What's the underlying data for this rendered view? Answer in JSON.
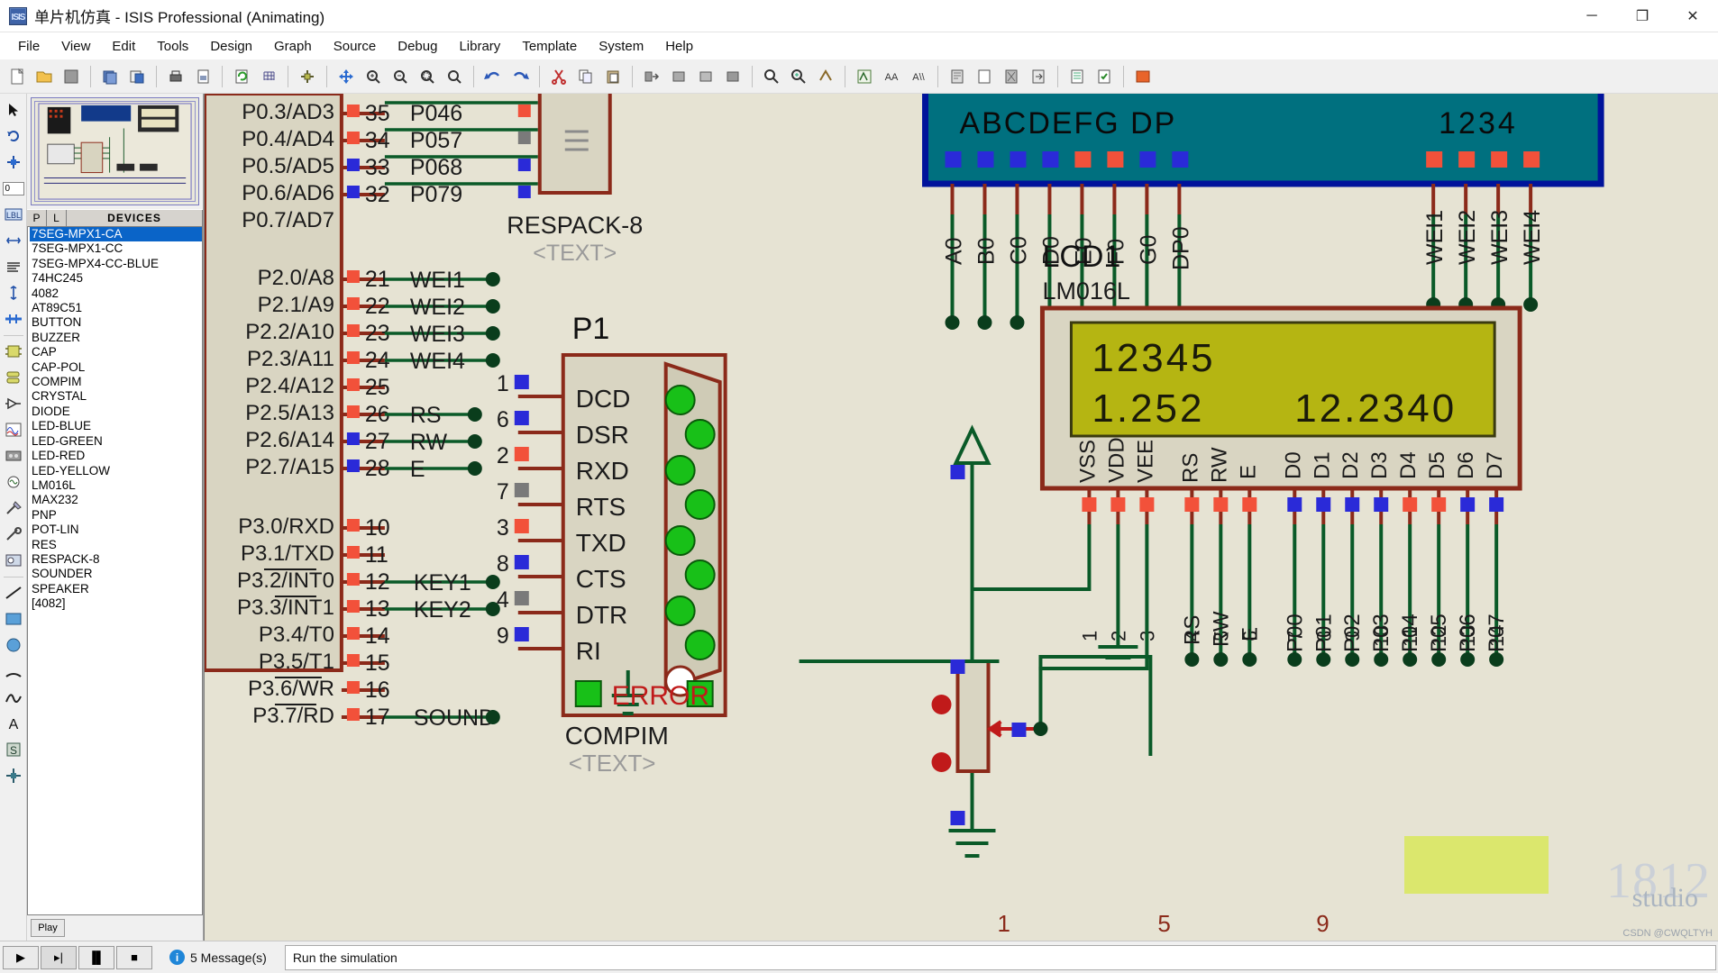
{
  "window": {
    "title": "单片机仿真 - ISIS Professional (Animating)",
    "app_icon": "isis-icon",
    "minimize": "─",
    "maximize": "❐",
    "close": "✕"
  },
  "menubar": {
    "items": [
      {
        "label": "File"
      },
      {
        "label": "View"
      },
      {
        "label": "Edit"
      },
      {
        "label": "Tools"
      },
      {
        "label": "Design"
      },
      {
        "label": "Graph"
      },
      {
        "label": "Source"
      },
      {
        "label": "Debug"
      },
      {
        "label": "Library"
      },
      {
        "label": "Template"
      },
      {
        "label": "System"
      },
      {
        "label": "Help"
      }
    ]
  },
  "toolbar": {
    "groups": [
      [
        "new-file-icon",
        "open-folder-icon",
        "save-icon"
      ],
      [
        "import-section-icon",
        "export-section-icon"
      ],
      [
        "print-icon",
        "print-region-icon"
      ],
      [
        "refresh-icon",
        "grid-icon"
      ],
      [
        "origin-icon"
      ],
      [
        "pan-icon",
        "zoom-in-icon",
        "zoom-out-icon",
        "zoom-area-icon",
        "zoom-all-icon"
      ],
      [
        "undo-icon",
        "redo-icon"
      ],
      [
        "cut-icon",
        "copy-icon",
        "paste-icon"
      ],
      [
        "block-copy-icon",
        "block-move-icon",
        "block-rotate-icon",
        "block-delete-icon"
      ],
      [
        "pick-device-icon",
        "make-device-icon",
        "packaging-icon",
        "decompose-icon"
      ],
      [
        "wire-autorouter-icon",
        "search-tag-icon",
        "property-assign-icon"
      ],
      [
        "design-explorer-icon",
        "new-sheet-icon",
        "remove-sheet-icon",
        "exit-sheet-icon"
      ],
      [
        "bill-materials-icon",
        "erc-report-icon"
      ],
      [
        "netlist-transfer-icon"
      ]
    ]
  },
  "vtoolbar": {
    "items": [
      {
        "name": "selection-mode-icon",
        "glyph": "arrow"
      },
      {
        "name": "component-mode-icon",
        "glyph": "comp"
      },
      {
        "name": "junction-dot-icon",
        "glyph": "junction"
      },
      {
        "name": "wire-label-icon",
        "glyph": "LBL"
      },
      {
        "name": "text-script-icon",
        "glyph": "text"
      },
      {
        "name": "bus-mode-icon",
        "glyph": "bus"
      },
      {
        "name": "subcircuit-icon",
        "glyph": "subckt"
      },
      {
        "name": "terminal-mode-icon",
        "glyph": "term"
      },
      {
        "name": "device-pin-icon",
        "glyph": "pin"
      },
      {
        "name": "graph-mode-icon",
        "glyph": "graph"
      },
      {
        "name": "tape-recorder-icon",
        "glyph": "tape"
      },
      {
        "name": "generator-mode-icon",
        "glyph": "gen"
      },
      {
        "name": "voltage-probe-icon",
        "glyph": "probe"
      },
      {
        "name": "current-probe-icon",
        "glyph": "iprobe"
      },
      {
        "name": "virtual-instrument-icon",
        "glyph": "instr"
      },
      {
        "name": "line-tool-icon",
        "glyph": "line"
      },
      {
        "name": "box-tool-icon",
        "glyph": "box"
      },
      {
        "name": "circle-tool-icon",
        "glyph": "circle"
      },
      {
        "name": "arc-tool-icon",
        "glyph": "arc"
      },
      {
        "name": "path-tool-icon",
        "glyph": "path"
      },
      {
        "name": "text-tool-icon",
        "glyph": "A"
      },
      {
        "name": "symbol-tool-icon",
        "glyph": "S"
      },
      {
        "name": "marker-tool-icon",
        "glyph": "marker"
      }
    ],
    "rotate_icons": [
      {
        "name": "rotate-clockwise-icon"
      },
      {
        "name": "rotate-anticlockwise-icon"
      }
    ],
    "rotate_value": "0",
    "mirror_icons": [
      {
        "name": "mirror-horizontal-icon"
      },
      {
        "name": "mirror-vertical-icon"
      }
    ]
  },
  "devices_panel": {
    "columns": [
      "P",
      "L",
      "DEVICES"
    ],
    "items": [
      "7SEG-MPX1-CA",
      "7SEG-MPX1-CC",
      "7SEG-MPX4-CC-BLUE",
      "74HC245",
      "4082",
      "AT89C51",
      "BUTTON",
      "BUZZER",
      "CAP",
      "CAP-POL",
      "COMPIM",
      "CRYSTAL",
      "DIODE",
      "LED-BLUE",
      "LED-GREEN",
      "LED-RED",
      "LED-YELLOW",
      "LM016L",
      "MAX232",
      "PNP",
      "POT-LIN",
      "RES",
      "RESPACK-8",
      "SOUNDER",
      "SPEAKER",
      "[4082]"
    ],
    "selected_index": 0,
    "play_label": "Play"
  },
  "schematic": {
    "mcu": {
      "port0_labels": [
        "P0.3/AD3",
        "P0.4/AD4",
        "P0.5/AD5",
        "P0.6/AD6",
        "P0.7/AD7"
      ],
      "port0_pins": [
        "35",
        "34",
        "33",
        "32"
      ],
      "port0_nets": [
        "P046",
        "P057",
        "P068",
        "P079"
      ],
      "port2_labels": [
        "P2.0/A8",
        "P2.1/A9",
        "P2.2/A10",
        "P2.3/A11",
        "P2.4/A12",
        "P2.5/A13",
        "P2.6/A14",
        "P2.7/A15"
      ],
      "port2_pins": [
        "21",
        "22",
        "23",
        "24",
        "25",
        "26",
        "27",
        "28"
      ],
      "port2_nets": [
        "WEI1",
        "WEI2",
        "WEI3",
        "WEI4",
        "",
        "RS",
        "RW",
        "E"
      ],
      "port3_labels": [
        "P3.0/RXD",
        "P3.1/TXD",
        "P3.2/INT0",
        "P3.3/INT1",
        "P3.4/T0",
        "P3.5/T1",
        "P3.6/WR",
        "P3.7/RD"
      ],
      "port3_pins": [
        "10",
        "11",
        "12",
        "13",
        "14",
        "15",
        "16",
        "17"
      ],
      "port3_nets": [
        "",
        "",
        "KEY1",
        "KEY2",
        "",
        "",
        "",
        "SOUND"
      ]
    },
    "respack": {
      "name": "RESPACK-8",
      "text": "<TEXT>"
    },
    "compim": {
      "ref": "P1",
      "name": "COMPIM",
      "text": "<TEXT>",
      "error_label": "ERROR",
      "pins": [
        {
          "num": "1",
          "label": "DCD"
        },
        {
          "num": "6",
          "label": "DSR"
        },
        {
          "num": "2",
          "label": "RXD"
        },
        {
          "num": "7",
          "label": "RTS"
        },
        {
          "num": "3",
          "label": "TXD"
        },
        {
          "num": "8",
          "label": "CTS"
        },
        {
          "num": "4",
          "label": "DTR"
        },
        {
          "num": "9",
          "label": "RI"
        }
      ]
    },
    "sevenseg": {
      "segment_header": "ABCDEFG DP",
      "digit_header": "1234",
      "seg_pin_labels": [
        "A0",
        "B0",
        "C0",
        "D0",
        "E0",
        "F0",
        "G0",
        "DP0"
      ],
      "wei_labels": [
        "WEI1",
        "WEI2",
        "WEI3",
        "WEI4"
      ]
    },
    "lcd": {
      "ref": "LCD1",
      "part": "LM016L",
      "line1": "12345",
      "line2_left": "1.252",
      "line2_right": "12.2340",
      "power_pins": [
        "VSS",
        "VDD",
        "VEE"
      ],
      "control_pins": [
        "RS",
        "RW",
        "E"
      ],
      "data_pins": [
        "D0",
        "D1",
        "D2",
        "D3",
        "D4",
        "D5",
        "D6",
        "D7"
      ],
      "pin_numbers": [
        "1",
        "2",
        "3",
        "4",
        "5",
        "6",
        "7",
        "8",
        "9",
        "10",
        "11",
        "12",
        "13",
        "14"
      ],
      "net_labels": [
        "RS",
        "RW",
        "E",
        "P00",
        "P01",
        "P02",
        "P03",
        "P04",
        "P05",
        "P06",
        "P07"
      ]
    },
    "sheet_markers": [
      "1",
      "5",
      "9"
    ]
  },
  "bottombar": {
    "buttons": [
      {
        "name": "play-button",
        "glyph": "▶"
      },
      {
        "name": "step-button",
        "glyph": "▸|"
      },
      {
        "name": "pause-button",
        "glyph": "▐▌"
      },
      {
        "name": "stop-button",
        "glyph": "■"
      }
    ],
    "messages": "5 Message(s)",
    "status": "Run the simulation"
  },
  "watermark": {
    "main": "1812",
    "sub": "studio",
    "credit": "CSDN @CWQLTYH"
  },
  "colors": {
    "accent_blue": "#0a64c8",
    "sheet_bg": "#e6e3d3",
    "wire_green": "#0a5a28",
    "body_red": "#8b2a1a",
    "lcd_screen": "#b5b512",
    "seg_display": "#00707f",
    "seg_border": "#00139b"
  }
}
